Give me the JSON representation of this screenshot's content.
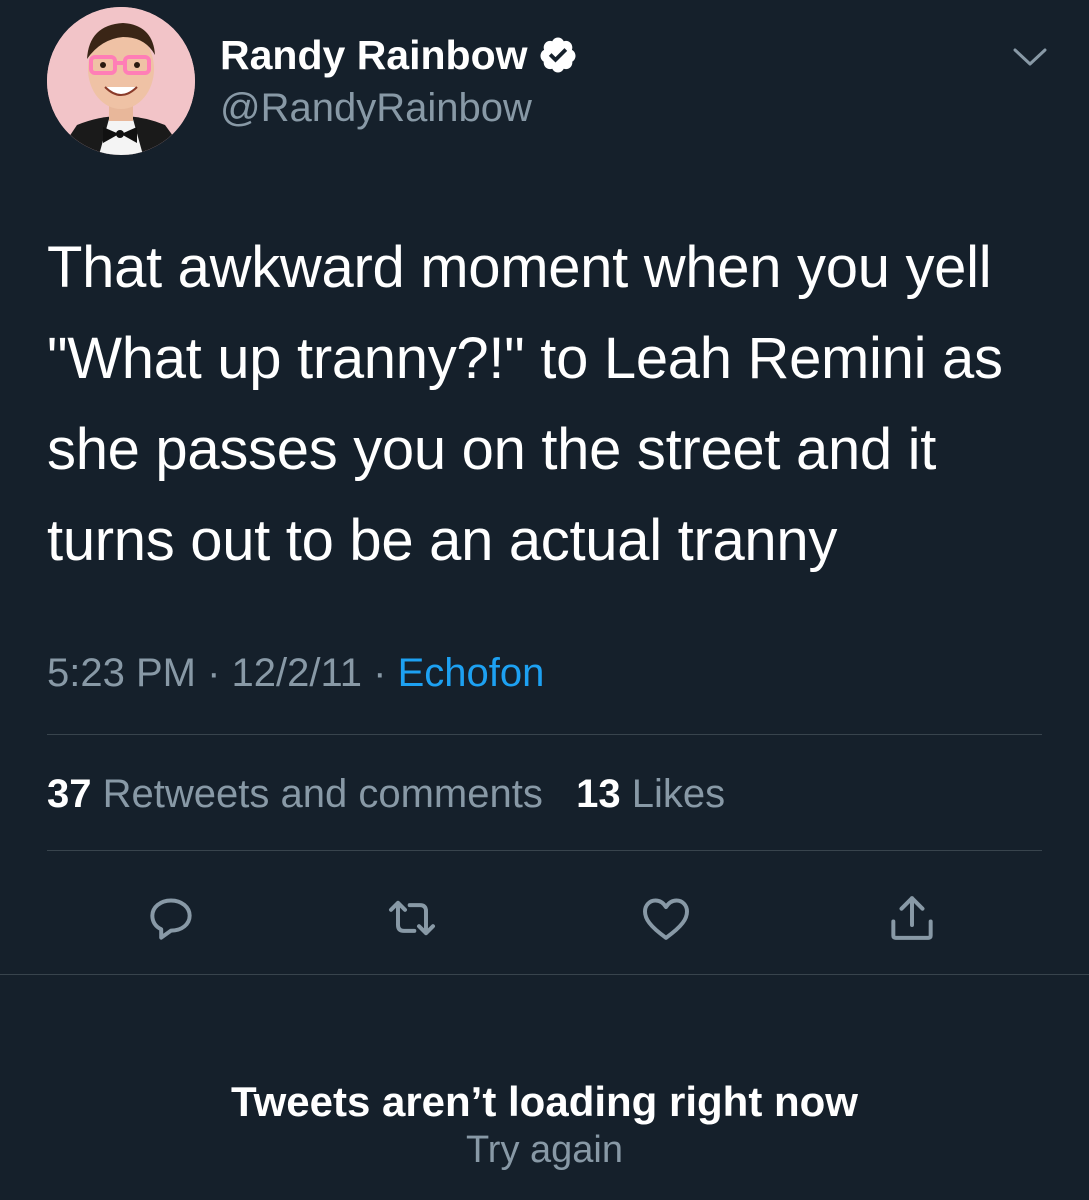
{
  "tweet": {
    "author": {
      "name": "Randy Rainbow",
      "handle": "@RandyRainbow",
      "verified": true
    },
    "text": "That awkward moment when you yell\n\"What up tranny?!\" to Leah Remini as\nshe passes you on the street and it\nturns out to be an actual tranny",
    "time": "5:23 PM",
    "separator": " · ",
    "date": "12/2/11",
    "source": "Echofon",
    "stats": {
      "retweets_count": "37",
      "retweets_label": "Retweets and comments",
      "likes_count": "13",
      "likes_label": "Likes"
    },
    "actions": [
      "reply-icon",
      "retweet-icon",
      "heart-icon",
      "share-icon"
    ]
  },
  "error": {
    "title": "Tweets aren’t loading right now",
    "retry_label": "Try again"
  },
  "colors": {
    "background": "#15202b",
    "text": "#ffffff",
    "secondary": "#8899a6",
    "accent": "#1da1f2",
    "divider": "#38444d"
  }
}
